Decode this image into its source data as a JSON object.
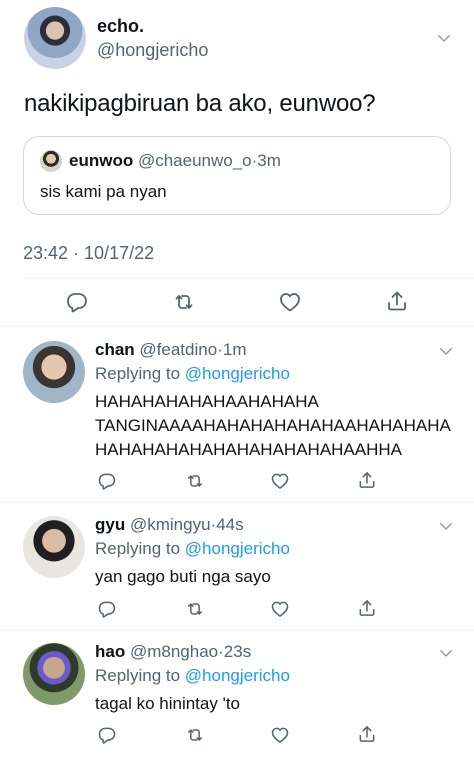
{
  "main_tweet": {
    "name": "echo.",
    "handle": "@hongjericho",
    "text": "nakikipagbiruan ba ako, eunwoo?",
    "quote": {
      "name": "eunwoo",
      "handle": "@chaeunwo_o",
      "dot": "·",
      "time": "3m",
      "text": "sis kami pa nyan"
    },
    "timestamp": "23:42 · 10/17/22"
  },
  "replying_label": "Replying to",
  "replies": [
    {
      "name": "chan",
      "handle": "@featdino",
      "dot": "·",
      "time": "1m",
      "replying_to": "@hongjericho",
      "text_lines": [
        "HAHAHAHAHAHAAHAHAHA",
        "TANGINAAAAHAHAHAHAHAHAAHAHAHAHA",
        "HAHAHAHAHAHAHAHAHAHAHAAHHA"
      ]
    },
    {
      "name": "gyu",
      "handle": "@kmingyu",
      "dot": "·",
      "time": "44s",
      "replying_to": "@hongjericho",
      "text_lines": [
        "yan gago buti nga sayo"
      ]
    },
    {
      "name": "hao",
      "handle": "@m8nghao",
      "dot": "·",
      "time": "23s",
      "replying_to": "@hongjericho",
      "text_lines": [
        "tagal ko hinintay 'to"
      ]
    }
  ],
  "icons": {
    "reply": "reply-icon",
    "retweet": "retweet-icon",
    "like": "heart-icon",
    "share": "share-icon",
    "more": "chevron-down-icon"
  },
  "colors": {
    "text": "#0f1419",
    "secondary": "#536471",
    "link": "#1d9bf0",
    "border": "#cfd9de",
    "divider": "#eff3f4"
  }
}
